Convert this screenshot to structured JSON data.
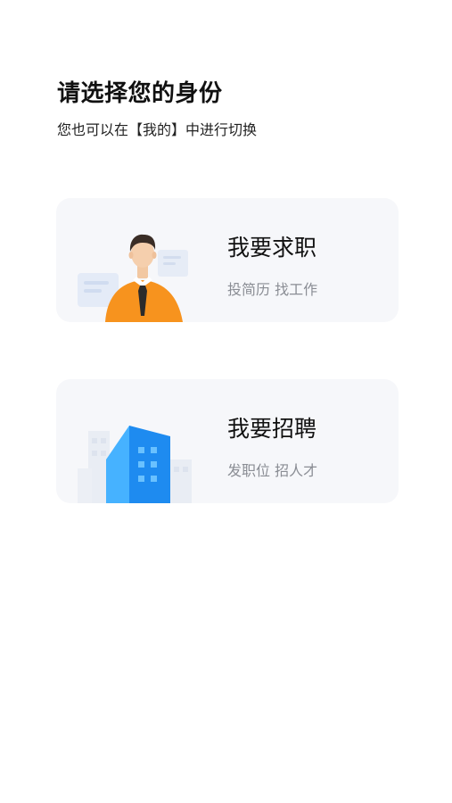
{
  "page": {
    "title": "请选择您的身份",
    "subtitle": "您也可以在【我的】中进行切换"
  },
  "roles": [
    {
      "title": "我要求职",
      "subtitle": "投简历 找工作",
      "icon": "job-seeker-icon"
    },
    {
      "title": "我要招聘",
      "subtitle": "发职位 招人才",
      "icon": "company-building-icon"
    }
  ],
  "colors": {
    "card_bg": "#f6f7fa",
    "person_shirt": "#f7931e",
    "building_blue": "#1e8bf0"
  }
}
